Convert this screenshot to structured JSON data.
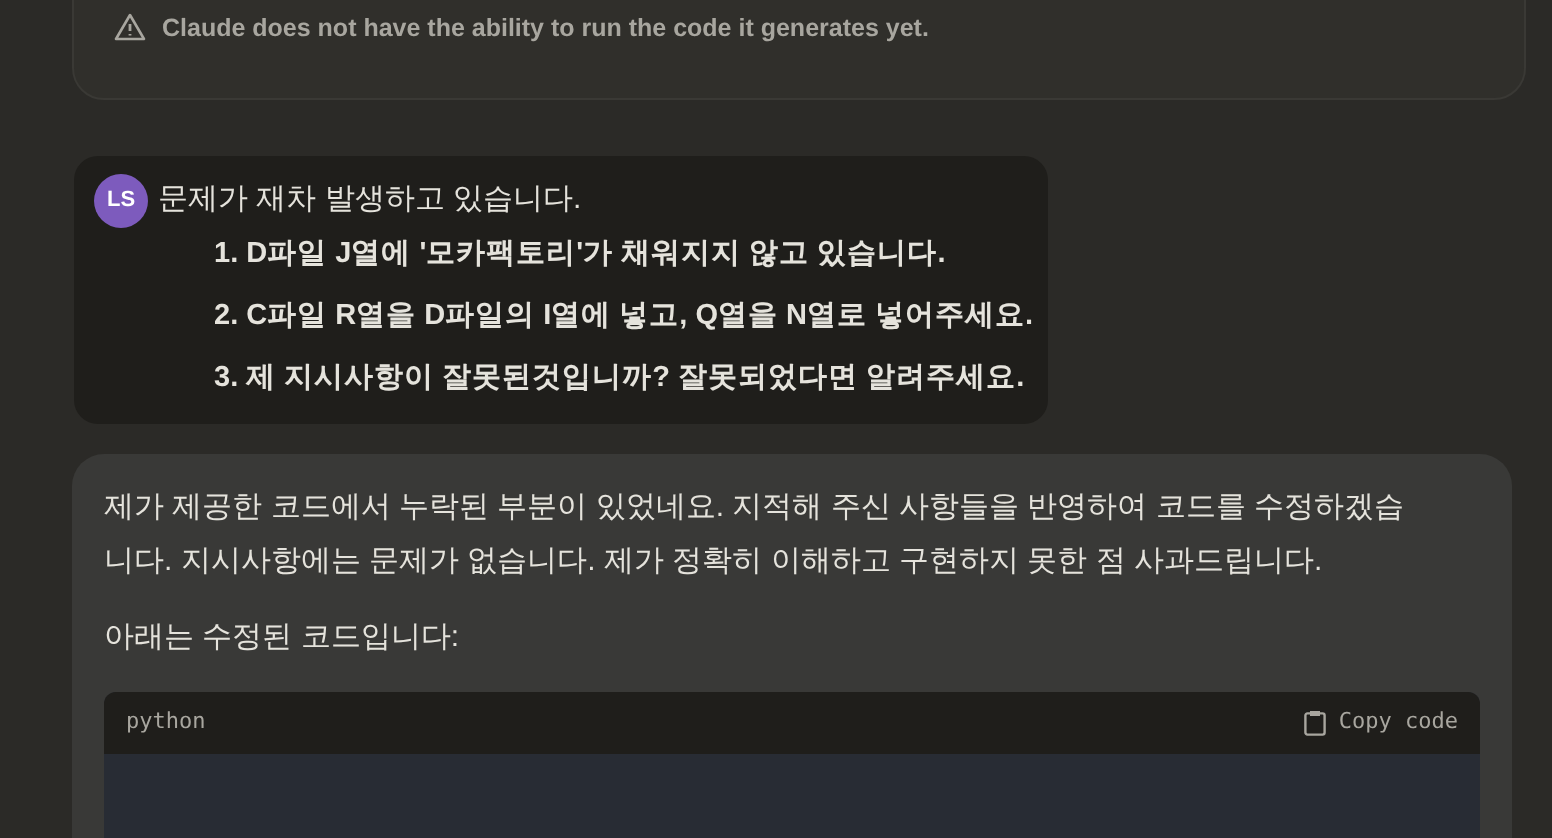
{
  "notice": {
    "text": "Claude does not have the ability to run the code it generates yet."
  },
  "user_message": {
    "avatar": "LS",
    "title": "문제가 재차 발생하고 있습니다.",
    "items": [
      "1. D파일 J열에 '모카팩토리'가 채워지지 않고 있습니다.",
      "2. C파일 R열을 D파일의 I열에 넣고, Q열을 N열로 넣어주세요.",
      "3. 제 지시사항이 잘못된것입니까? 잘못되었다면 알려주세요."
    ]
  },
  "assistant_message": {
    "paragraphs": [
      "제가 제공한 코드에서 누락된 부분이 있었네요. 지적해 주신 사항들을 반영하여 코드를 수정하겠습니다. 지시사항에는 문제가 없습니다. 제가 정확히 이해하고 구현하지 못한 점 사과드립니다.",
      "아래는 수정된 코드입니다:"
    ],
    "code_block": {
      "language": "python",
      "copy_label": "Copy code"
    }
  }
}
